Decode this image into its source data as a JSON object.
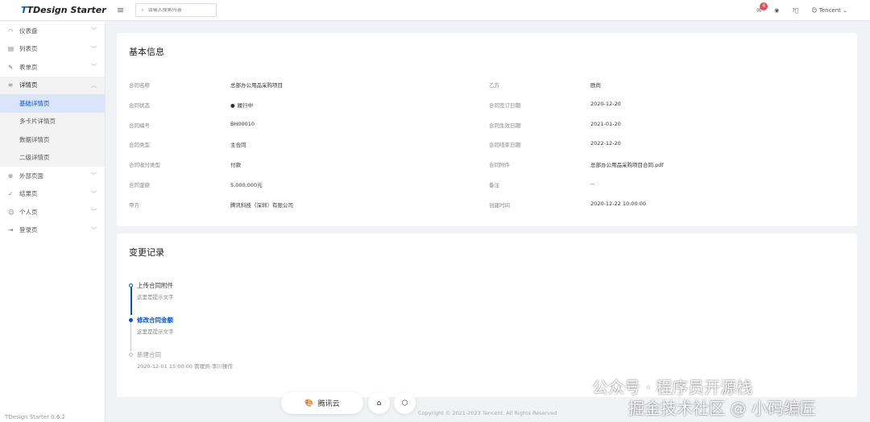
{
  "header": {
    "logo": "TDesign Starter",
    "search_placeholder": "请输入搜索内容",
    "notification_count": "6",
    "user": "Tencent"
  },
  "sidebar": {
    "items": [
      {
        "label": "仪表盘",
        "icon": "dashboard-icon"
      },
      {
        "label": "列表页",
        "icon": "list-icon"
      },
      {
        "label": "表单页",
        "icon": "edit-icon"
      },
      {
        "label": "详情页",
        "icon": "layers-icon"
      },
      {
        "label": "外部页面",
        "icon": "globe-icon"
      },
      {
        "label": "结果页",
        "icon": "check-circle-icon"
      },
      {
        "label": "个人页",
        "icon": "user-circle-icon"
      },
      {
        "label": "登录页",
        "icon": "logout-icon"
      }
    ],
    "sub_items": [
      "基础详情页",
      "多卡片详情页",
      "数据详情页",
      "二级详情页"
    ],
    "version": "TDesign Starter 0.6.2"
  },
  "basic": {
    "title": "基本信息",
    "left": [
      {
        "k": "合同名称",
        "v": "总部办公用品采购项目"
      },
      {
        "k": "合同状态",
        "v": "履行中"
      },
      {
        "k": "合同编号",
        "v": "BH00010"
      },
      {
        "k": "合同类型",
        "v": "主合同"
      },
      {
        "k": "合同收付类型",
        "v": "付款"
      },
      {
        "k": "合同金额",
        "v": "5,000,000元"
      },
      {
        "k": "甲方",
        "v": "腾讯科技（深圳）有限公司"
      }
    ],
    "right": [
      {
        "k": "乙方",
        "v": "欧尚"
      },
      {
        "k": "合同签订日期",
        "v": "2020-12-20"
      },
      {
        "k": "合同生效日期",
        "v": "2021-01-20"
      },
      {
        "k": "合同结束日期",
        "v": "2022-12-20"
      },
      {
        "k": "合同附件",
        "v": "总部办公用品采购项目合同.pdf"
      },
      {
        "k": "备注",
        "v": "--"
      },
      {
        "k": "创建时间",
        "v": "2020-12-22 10:00:00"
      }
    ]
  },
  "changes": {
    "title": "变更记录",
    "items": [
      {
        "t": "上传合同附件",
        "d": "这里是提示文字"
      },
      {
        "t": "修改合同金额",
        "d": "这里是提示文字"
      },
      {
        "t": "新建合同",
        "d": "2020-12-01 15:00:00 管理员-李川操作"
      }
    ]
  },
  "footer": "Copyright © 2021-2023 Tencent. All Rights Reserved",
  "float": {
    "brand": "腾讯云"
  },
  "watermark": {
    "line1": "公众号 · 程序员开源栈",
    "line2": "掘金技术社区 @ 小码编匠"
  },
  "colors": {
    "primary": "#0052d9",
    "success": "#2ba471",
    "danger": "#e34d59"
  }
}
